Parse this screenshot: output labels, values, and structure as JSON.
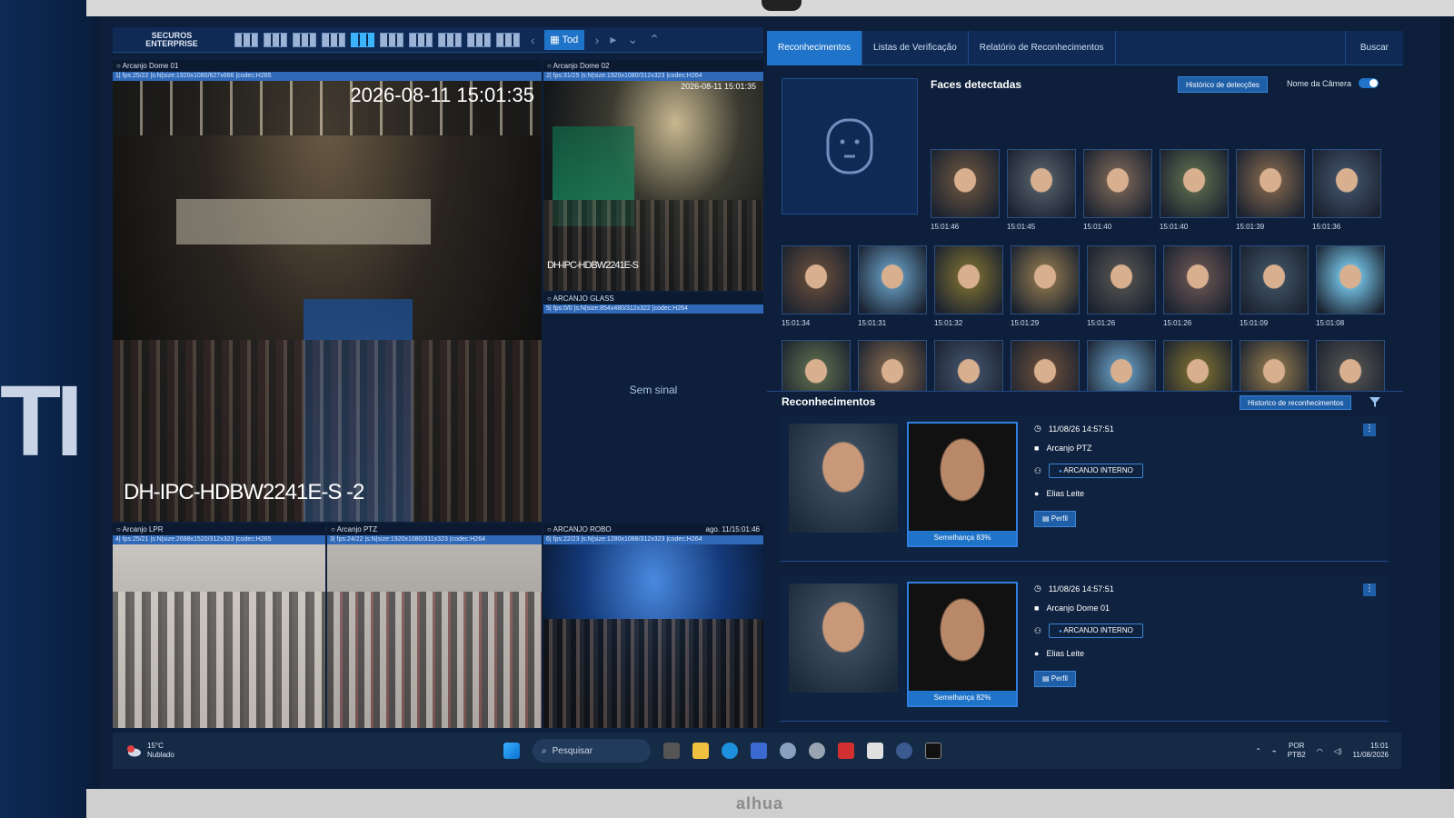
{
  "software": {
    "logo_line1": "SECUROS",
    "logo_line2": "ENTERPRISE"
  },
  "toolbar": {
    "view_selector_label": "Tod"
  },
  "tiles": [
    {
      "title": "Arcanjo Dome 01",
      "info": "1| fps:25/22 |s:N|size:1920x1080/627x666 |codec:H265",
      "timestamp": "2026-08-11 15:01:35",
      "model": "DH-IPC-HDBW2241E-S -2"
    },
    {
      "title": "Arcanjo Dome 02",
      "info": "2| fps:31/25 |s:N|size:1920x1080/312x323 |codec:H264",
      "timestamp": "2026-08-11 15:01:35",
      "model": "DH-IPC-HDBW2241E-S"
    },
    {
      "title": "ARCANJO GLASS",
      "info": "5| fps:0/0 |s:N|size:854x480/312x322 |codec:H264",
      "status": "Sem sinal"
    },
    {
      "title": "Arcanjo LPR",
      "info": "4| fps:25/21 |s:N|size:2688x1520/312x323 |codec:H265"
    },
    {
      "title": "Arcanjo PTZ",
      "info": "3| fps:24/22 |s:N|size:1920x1080/311x323 |codec:H264"
    },
    {
      "title": "ARCANJO ROBO",
      "stamp": "ago. 11/15:01:46",
      "info": "6| fps:22/23 |s:N|size:1280x1088/312x323 |codec:H264"
    }
  ],
  "tabs": [
    "Reconhecimentos",
    "Listas de Verificação",
    "Relatório de Reconhecimentos"
  ],
  "search_label": "Buscar",
  "faces_panel": {
    "title": "Faces detectadas",
    "history_button": "Histórico de detecções",
    "camera_name_toggle": "Nome da Câmera",
    "row1_times": [
      "15:01:46",
      "15:01:45",
      "15:01:40",
      "15:01:40",
      "15:01:39",
      "15:01:36"
    ],
    "row2_times": [
      "15:01:34",
      "15:01:31",
      "15:01:32",
      "15:01:29",
      "15:01:26",
      "15:01:26",
      "15:01:09",
      "15:01:08"
    ],
    "row3_count": 8,
    "tile_colors": [
      "#5a4a3c",
      "#4a5560",
      "#6a5a50",
      "#525f48",
      "#6f5a48",
      "#3c4a60",
      "#5a4538",
      "#5a87a8",
      "#6a6030",
      "#7a6848",
      "#4a4a4a",
      "#5c4c4c",
      "#3a4a5a",
      "#6ab0d0"
    ]
  },
  "recognitions": {
    "title": "Reconhecimentos",
    "history_button": "Historico de reconhecimentos",
    "items": [
      {
        "datetime": "11/08/26 14:57:51",
        "camera": "Arcanjo PTZ",
        "list": "ARCANJO INTERNO",
        "person": "Elias Leite",
        "profile_button": "Perfil",
        "similarity": "Semelhança 83%"
      },
      {
        "datetime": "11/08/26 14:57:51",
        "camera": "Arcanjo Dome 01",
        "list": "ARCANJO INTERNO",
        "person": "Elias Leite",
        "profile_button": "Perfil",
        "similarity": "Semelhança 82%"
      }
    ]
  },
  "taskbar": {
    "weather_temp": "15°C",
    "weather_desc": "Nublado",
    "search_placeholder": "Pesquisar",
    "lang_line1": "POR",
    "lang_line2": "PTB2",
    "clock_time": "15:01",
    "clock_date": "11/08/2026"
  },
  "wall_text": "TI",
  "monitor_brand": "alhua"
}
